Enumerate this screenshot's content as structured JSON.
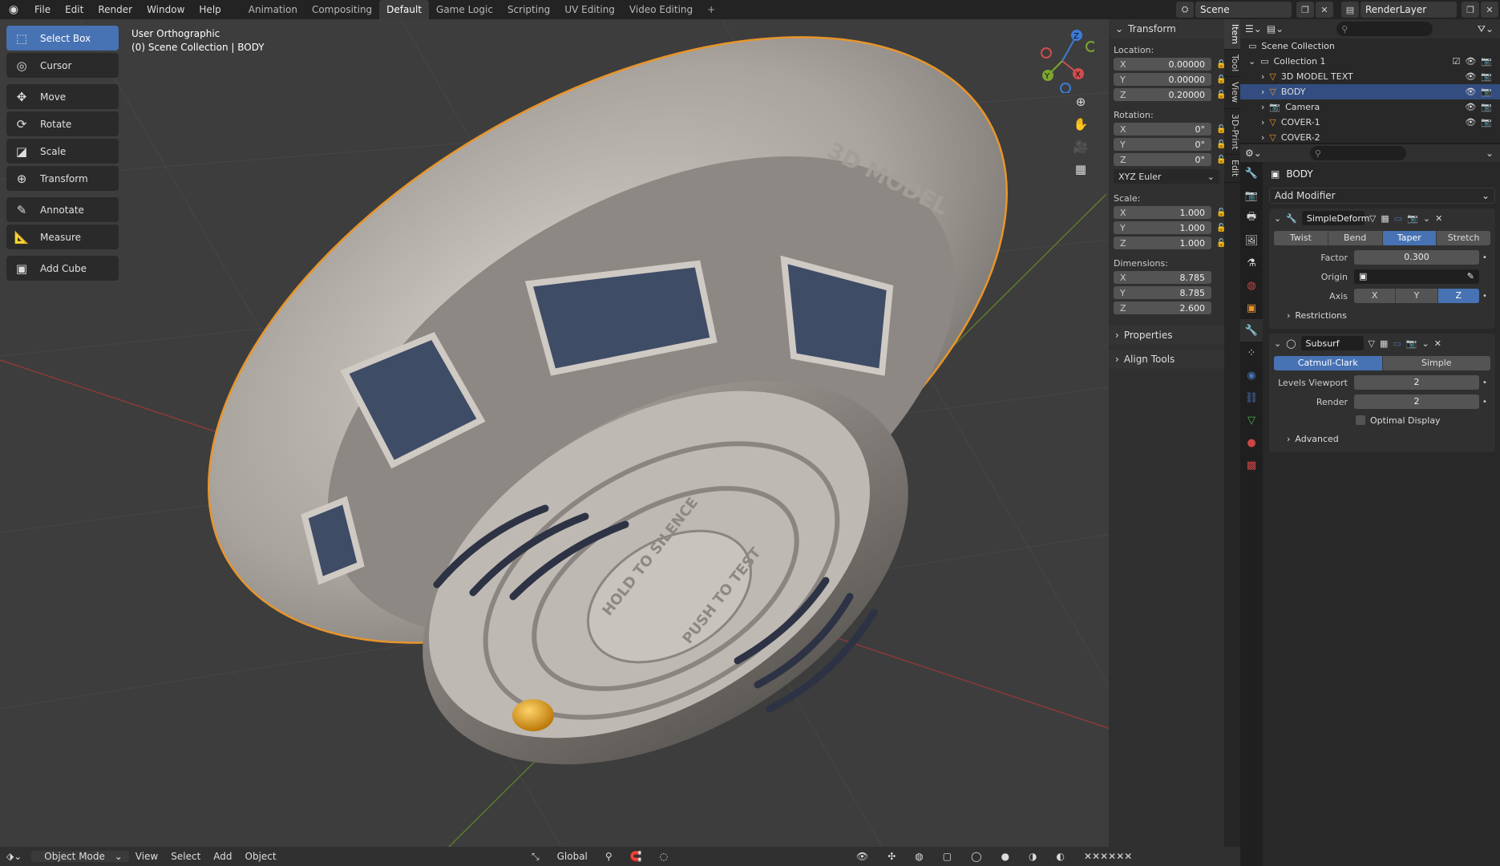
{
  "topbar": {
    "menu": [
      "File",
      "Edit",
      "Render",
      "Window",
      "Help"
    ],
    "workspaces": [
      "Animation",
      "Compositing",
      "Default",
      "Game Logic",
      "Scripting",
      "UV Editing",
      "Video Editing"
    ],
    "active_workspace": "Default",
    "plus": "+",
    "scene": "Scene",
    "render_layer": "RenderLayer"
  },
  "viewport": {
    "view_name": "User Orthographic",
    "collection": "(0) Scene Collection | BODY",
    "model_text": "3D MODEL",
    "hold_text": "HOLD TO SILENCE",
    "push_text": "PUSH TO TEST"
  },
  "toolbar": {
    "tools": [
      "Select Box",
      "Cursor",
      "Move",
      "Rotate",
      "Scale",
      "Transform",
      "Annotate",
      "Measure",
      "Add Cube"
    ]
  },
  "gizmo": {
    "x": "X",
    "y": "Y",
    "z": "Z"
  },
  "npanel": {
    "title": "Transform",
    "location_label": "Location:",
    "location": [
      "0.00000",
      "0.00000",
      "0.20000"
    ],
    "rotation_label": "Rotation:",
    "rotation": [
      "0°",
      "0°",
      "0°"
    ],
    "rotation_mode": "XYZ Euler",
    "scale_label": "Scale:",
    "scale": [
      "1.000",
      "1.000",
      "1.000"
    ],
    "dimensions_label": "Dimensions:",
    "dimensions": [
      "8.785",
      "8.785",
      "2.600"
    ],
    "axes": [
      "X",
      "Y",
      "Z"
    ],
    "properties": "Properties",
    "align_tools": "Align Tools"
  },
  "side_tabs": [
    "Item",
    "Tool",
    "View",
    "3D-Print",
    "Edit"
  ],
  "statusbar": {
    "mode": "Object Mode",
    "menus": [
      "View",
      "Select",
      "Add",
      "Object"
    ],
    "orientation": "Global"
  },
  "outliner": {
    "root": "Scene Collection",
    "collection": "Collection 1",
    "items": [
      "3D MODEL TEXT",
      "BODY",
      "Camera",
      "COVER-1",
      "COVER-2"
    ],
    "selected": "BODY"
  },
  "properties": {
    "object": "BODY",
    "add_modifier": "Add Modifier",
    "mod1": {
      "name": "SimpleDeform",
      "modes": [
        "Twist",
        "Bend",
        "Taper",
        "Stretch"
      ],
      "active_mode": "Taper",
      "factor_label": "Factor",
      "factor": "0.300",
      "origin_label": "Origin",
      "axis_label": "Axis",
      "axis": "Z",
      "restrictions": "Restrictions"
    },
    "mod2": {
      "name": "Subsurf",
      "types": [
        "Catmull-Clark",
        "Simple"
      ],
      "active_type": "Catmull-Clark",
      "levels_label": "Levels Viewport",
      "levels": "2",
      "render_label": "Render",
      "render": "2",
      "optimal": "Optimal Display",
      "advanced": "Advanced"
    }
  },
  "colors": {
    "accent": "#4772b3",
    "selection": "#e8952b",
    "viewport": "#3d3d3d",
    "body": "#b8b2ac"
  }
}
